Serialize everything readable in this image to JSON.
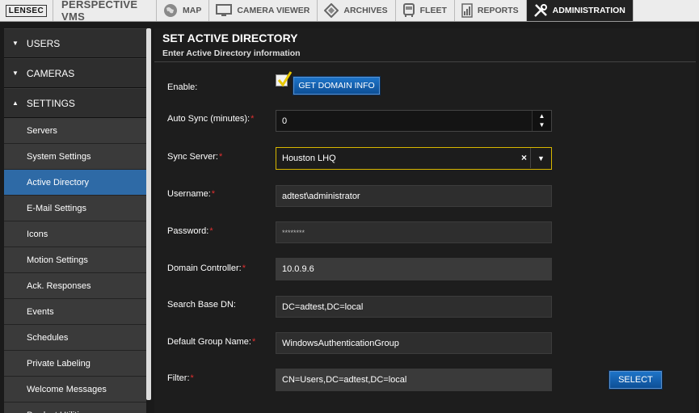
{
  "topbar": {
    "logo": "LENSEC",
    "app_title": "PERSPECTIVE VMS",
    "tabs": [
      {
        "label": "MAP",
        "icon": "globe-icon"
      },
      {
        "label": "CAMERA VIEWER",
        "icon": "monitor-icon"
      },
      {
        "label": "ARCHIVES",
        "icon": "archive-diamond-icon"
      },
      {
        "label": "FLEET",
        "icon": "bus-icon"
      },
      {
        "label": "REPORTS",
        "icon": "report-icon"
      },
      {
        "label": "ADMINISTRATION",
        "icon": "tools-icon",
        "active": true
      }
    ]
  },
  "sidebar": {
    "sections": [
      {
        "label": "USERS",
        "state": "collapsed"
      },
      {
        "label": "CAMERAS",
        "state": "collapsed"
      },
      {
        "label": "SETTINGS",
        "state": "expanded"
      }
    ],
    "items": [
      {
        "label": "Servers"
      },
      {
        "label": "System Settings"
      },
      {
        "label": "Active Directory",
        "active": true
      },
      {
        "label": "E-Mail Settings"
      },
      {
        "label": "Icons"
      },
      {
        "label": "Motion Settings"
      },
      {
        "label": "Ack. Responses"
      },
      {
        "label": "Events"
      },
      {
        "label": "Schedules"
      },
      {
        "label": "Private Labeling"
      },
      {
        "label": "Welcome Messages"
      },
      {
        "label": "Product Utilities"
      }
    ]
  },
  "main": {
    "title": "SET ACTIVE DIRECTORY",
    "subtitle": "Enter Active Directory information",
    "enable": {
      "label": "Enable:",
      "checked": true
    },
    "get_domain_button": "GET DOMAIN INFO",
    "auto_sync": {
      "label": "Auto Sync (minutes):",
      "required": "*",
      "value": "0"
    },
    "sync_server": {
      "label": "Sync Server:",
      "required": "*",
      "value": "Houston LHQ",
      "clear": "×",
      "dropdown": "▼"
    },
    "username": {
      "label": "Username:",
      "required": "*",
      "value": "adtest\\administrator"
    },
    "password": {
      "label": "Password:",
      "required": "*",
      "value": "********"
    },
    "domain_controller": {
      "label": "Domain Controller:",
      "required": "*",
      "value": "10.0.9.6"
    },
    "search_base_dn": {
      "label": "Search Base DN:",
      "value": "DC=adtest,DC=local"
    },
    "default_group": {
      "label": "Default Group Name:",
      "required": "*",
      "value": "WindowsAuthenticationGroup"
    },
    "filter": {
      "label": "Filter:",
      "required": "*",
      "value": "CN=Users,DC=adtest,DC=local"
    },
    "select_button": "SELECT"
  },
  "colors": {
    "accent": "#2e6aa6",
    "required": "#e03030",
    "select_border": "#d8b700"
  }
}
